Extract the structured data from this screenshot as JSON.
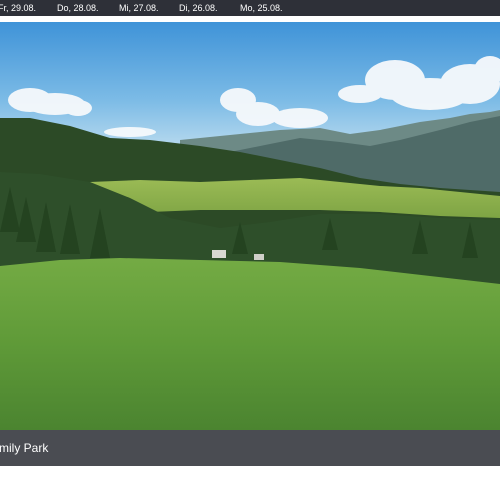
{
  "date_tabs": [
    {
      "label": "Fr, 29.08."
    },
    {
      "label": "Do, 28.08."
    },
    {
      "label": "Mi, 27.08."
    },
    {
      "label": "Di, 26.08."
    },
    {
      "label": "Mo, 25.08."
    }
  ],
  "webcam": {
    "caption": "mily Park"
  },
  "colors": {
    "date_bar": "#2e3038",
    "caption_bar": "#4a4c52",
    "sky": "#5fa8dc",
    "meadow": "#5f9a3a"
  }
}
